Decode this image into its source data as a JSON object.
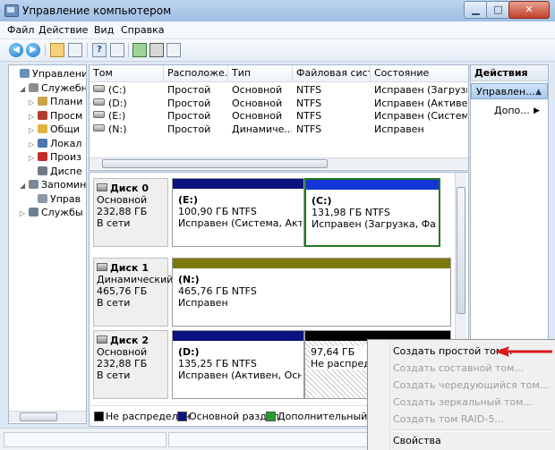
{
  "window": {
    "title": "Управление компьютером"
  },
  "menu": [
    "Файл",
    "Действие",
    "Вид",
    "Справка"
  ],
  "tree": {
    "items": [
      {
        "label": "Управление к",
        "indent": 0,
        "expander": "",
        "icon": "computer-management-icon",
        "color": "#6b8fb9"
      },
      {
        "label": "Служебны",
        "indent": 1,
        "expander": "◢",
        "icon": "tools-icon",
        "color": "#8e8e8e"
      },
      {
        "label": "Плани",
        "indent": 2,
        "expander": "▷",
        "icon": "task-scheduler-icon",
        "color": "#c9a34a"
      },
      {
        "label": "Просм",
        "indent": 2,
        "expander": "▷",
        "icon": "event-viewer-icon",
        "color": "#b23c2c"
      },
      {
        "label": "Общи",
        "indent": 2,
        "expander": "▷",
        "icon": "shared-folders-icon",
        "color": "#e2b53f"
      },
      {
        "label": "Локал",
        "indent": 2,
        "expander": "▷",
        "icon": "local-users-icon",
        "color": "#4d77b0"
      },
      {
        "label": "Произ",
        "indent": 2,
        "expander": "▷",
        "icon": "performance-icon",
        "color": "#c62b2b"
      },
      {
        "label": "Диспе",
        "indent": 2,
        "expander": "",
        "icon": "device-manager-icon",
        "color": "#707a86"
      },
      {
        "label": "Запомина",
        "indent": 1,
        "expander": "◢",
        "icon": "storage-icon",
        "color": "#7c8896"
      },
      {
        "label": "Управ",
        "indent": 2,
        "expander": "",
        "icon": "disk-management-icon",
        "color": "#8c98a6"
      },
      {
        "label": "Службы и",
        "indent": 1,
        "expander": "▷",
        "icon": "services-icon",
        "color": "#6f7f93"
      }
    ]
  },
  "table": {
    "columns": [
      "Том",
      "Расположе...",
      "Тип",
      "Файловая сист...",
      "Состояние"
    ],
    "rows": [
      [
        "(C:)",
        "Простой",
        "Основной",
        "NTFS",
        "Исправен (Загрузка,"
      ],
      [
        "(D:)",
        "Простой",
        "Основной",
        "NTFS",
        "Исправен (Активен,"
      ],
      [
        "(E:)",
        "Простой",
        "Основной",
        "NTFS",
        "Исправен (Система,"
      ],
      [
        "(N:)",
        "Простой",
        "Динамиче...",
        "NTFS",
        "Исправен"
      ]
    ]
  },
  "disks": [
    {
      "name": "Диск 0",
      "type": "Основной",
      "size": "232,88 ГБ",
      "status": "В сети",
      "partitions": [
        {
          "label": "(E:)",
          "size": "100,90 ГБ NTFS",
          "status": "Исправен (Система, Активен",
          "color": "#0b137f",
          "selected": false,
          "hatched": false
        },
        {
          "label": "(C:)",
          "size": "131,98 ГБ NTFS",
          "status": "Исправен (Загрузка, Файл п",
          "color": "#1436d9",
          "selected": true,
          "hatched": false
        }
      ]
    },
    {
      "name": "Диск 1",
      "type": "Динамический",
      "size": "465,76 ГБ",
      "status": "В сети",
      "partitions": [
        {
          "label": "(N:)",
          "size": "465,76 ГБ NTFS",
          "status": "Исправен",
          "color": "#7c7a0f",
          "selected": false,
          "hatched": false
        }
      ]
    },
    {
      "name": "Диск 2",
      "type": "Основной",
      "size": "232,88 ГБ",
      "status": "В сети",
      "partitions": [
        {
          "label": "(D:)",
          "size": "135,25 ГБ NTFS",
          "status": "Исправен (Активен, Основно",
          "color": "#0b137f",
          "selected": false,
          "hatched": false
        },
        {
          "label": "",
          "size": "97,64 ГБ",
          "status": "Не распредел",
          "color": "#000000",
          "selected": false,
          "hatched": true
        }
      ]
    }
  ],
  "legend": [
    {
      "label": "Не распределен",
      "color": "#000000"
    },
    {
      "label": "Основной раздел",
      "color": "#0b137f"
    },
    {
      "label": "Дополнительный раз",
      "color": "#1fa12a"
    }
  ],
  "actions": {
    "header": "Действия",
    "selected": "Управлен...",
    "more": "Допо..."
  },
  "context_menu": {
    "items": [
      {
        "label": "Создать простой том...",
        "enabled": true
      },
      {
        "label": "Создать составной том...",
        "enabled": false
      },
      {
        "label": "Создать чередующийся том...",
        "enabled": false
      },
      {
        "label": "Создать зеркальный том...",
        "enabled": false
      },
      {
        "label": "Создать том RAID-5...",
        "enabled": false
      }
    ],
    "properties": "Свойства"
  },
  "colors": {
    "annotation_arrow": "#d8191d"
  }
}
